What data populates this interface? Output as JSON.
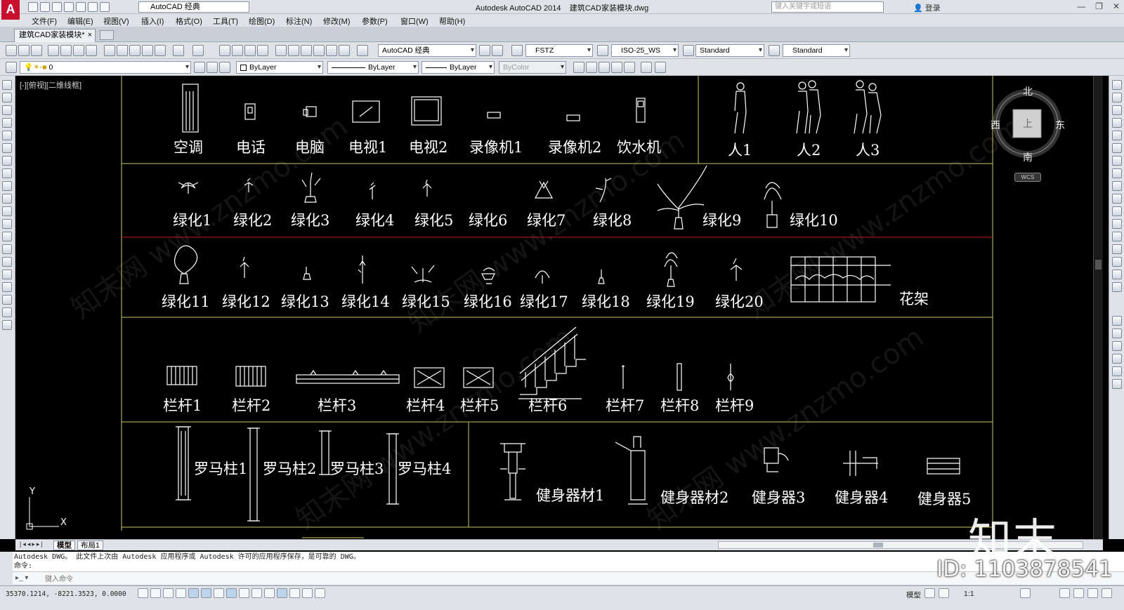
{
  "title_bar": {
    "app_name": "Autodesk AutoCAD 2014",
    "file_name": "建筑CAD家装模块.dwg",
    "workspace": "AutoCAD 经典",
    "search_placeholder": "键入关键字或短语",
    "login_label": "登录"
  },
  "menu": [
    "文件(F)",
    "编辑(E)",
    "视图(V)",
    "插入(I)",
    "格式(O)",
    "工具(T)",
    "绘图(D)",
    "标注(N)",
    "修改(M)",
    "参数(P)",
    "窗口(W)",
    "帮助(H)"
  ],
  "doc_tab": "建筑CAD家装模块*",
  "toolbar": {
    "workspace_combo": "AutoCAD 经典",
    "text_style": "FSTZ",
    "dim_style": "ISO-25_WS",
    "table_style": "Standard",
    "mleader_style": "Standard",
    "layer": "0",
    "color": "ByLayer",
    "linetype": "ByLayer",
    "lineweight": "ByLayer",
    "plot_style": "ByColor"
  },
  "viewport_label": "[-][俯视][二维线框]",
  "viewcube": {
    "north": "北",
    "south": "南",
    "east": "东",
    "west": "西",
    "face": "上",
    "wcs": "WCS"
  },
  "ucs": {
    "x": "X",
    "y": "Y"
  },
  "drawing": {
    "row1": [
      "空调",
      "电话",
      "电脑",
      "电视1",
      "电视2",
      "录像机1",
      "录像机2",
      "饮水机"
    ],
    "people": [
      "人1",
      "人2",
      "人3"
    ],
    "row2": [
      "绿化1",
      "绿化2",
      "绿化3",
      "绿化4",
      "绿化5",
      "绿化6",
      "绿化7",
      "绿化8",
      "绿化9",
      "绿化10"
    ],
    "row3": [
      "绿化11",
      "绿化12",
      "绿化13",
      "绿化14",
      "绿化15",
      "绿化16",
      "绿化17",
      "绿化18",
      "绿化19",
      "绿化20",
      "花架"
    ],
    "row4": [
      "栏杆1",
      "栏杆2",
      "栏杆3",
      "栏杆4",
      "栏杆5",
      "栏杆6",
      "栏杆7",
      "栏杆8",
      "栏杆9"
    ],
    "row5_columns": [
      "罗马柱1",
      "罗马柱2",
      "罗马柱3",
      "罗马柱4"
    ],
    "row5_fitness": [
      "健身器材1",
      "健身器材2",
      "健身器3",
      "健身器4",
      "健身器5"
    ]
  },
  "layout_tabs": {
    "model": "模型",
    "layout1": "布局1"
  },
  "command": {
    "history_line1": "Autodesk DWG。  此文件上次由 Autodesk 应用程序或 Autodesk 许可的应用程序保存，是可靠的 DWG。",
    "history_line2": "命令:",
    "placeholder": "键入命令"
  },
  "status": {
    "coordinates": "35370.1214, -8221.3523, 0.0000",
    "model_label": "模型",
    "scale": "1:1"
  },
  "watermark": {
    "brand": "知末",
    "id": "ID: 1103878541"
  },
  "colors": {
    "canvas_bg": "#000000",
    "frame_line": "#c8c860",
    "red_line": "#c81e1e",
    "chrome": "#dfe3e8"
  }
}
